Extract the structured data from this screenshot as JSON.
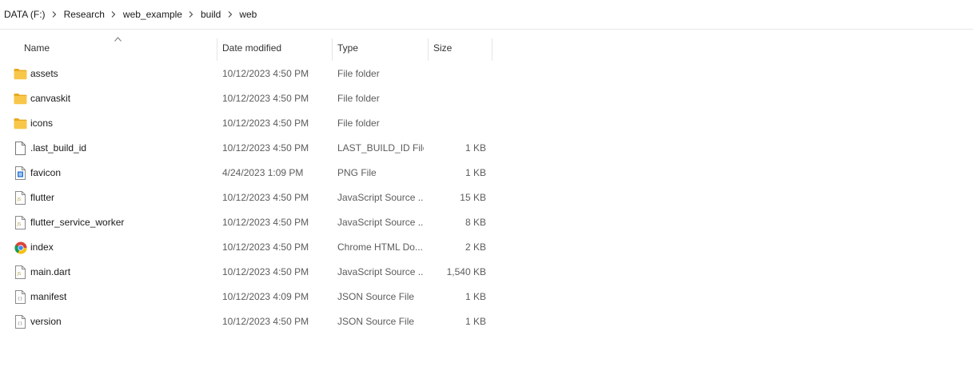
{
  "breadcrumb": [
    {
      "label": "DATA (F:)"
    },
    {
      "label": "Research"
    },
    {
      "label": "web_example"
    },
    {
      "label": "build"
    },
    {
      "label": "web"
    }
  ],
  "columns": {
    "name": "Name",
    "date": "Date modified",
    "type": "Type",
    "size": "Size",
    "sorted_by": "Name"
  },
  "files": [
    {
      "name": "assets",
      "date": "10/12/2023 4:50 PM",
      "type": "File folder",
      "size": "",
      "icon": "folder-icon"
    },
    {
      "name": "canvaskit",
      "date": "10/12/2023 4:50 PM",
      "type": "File folder",
      "size": "",
      "icon": "folder-icon"
    },
    {
      "name": "icons",
      "date": "10/12/2023 4:50 PM",
      "type": "File folder",
      "size": "",
      "icon": "folder-icon"
    },
    {
      "name": ".last_build_id",
      "date": "10/12/2023 4:50 PM",
      "type": "LAST_BUILD_ID File",
      "size": "1 KB",
      "icon": "blank-file-icon"
    },
    {
      "name": "favicon",
      "date": "4/24/2023 1:09 PM",
      "type": "PNG File",
      "size": "1 KB",
      "icon": "image-file-icon"
    },
    {
      "name": "flutter",
      "date": "10/12/2023 4:50 PM",
      "type": "JavaScript Source ...",
      "size": "15 KB",
      "icon": "js-file-icon"
    },
    {
      "name": "flutter_service_worker",
      "date": "10/12/2023 4:50 PM",
      "type": "JavaScript Source ...",
      "size": "8 KB",
      "icon": "js-file-icon"
    },
    {
      "name": "index",
      "date": "10/12/2023 4:50 PM",
      "type": "Chrome HTML Do...",
      "size": "2 KB",
      "icon": "chrome-icon"
    },
    {
      "name": "main.dart",
      "date": "10/12/2023 4:50 PM",
      "type": "JavaScript Source ...",
      "size": "1,540 KB",
      "icon": "js-file-icon"
    },
    {
      "name": "manifest",
      "date": "10/12/2023 4:09 PM",
      "type": "JSON Source File",
      "size": "1 KB",
      "icon": "json-file-icon"
    },
    {
      "name": "version",
      "date": "10/12/2023 4:50 PM",
      "type": "JSON Source File",
      "size": "1 KB",
      "icon": "json-file-icon"
    }
  ],
  "colors": {
    "folder": "#f8c74a",
    "folder_dark": "#e9a820",
    "chrome_red": "#db4437",
    "chrome_yellow": "#f4c20d",
    "chrome_green": "#0f9d58",
    "chrome_blue": "#4285f4",
    "image_blue": "#1e6fd1",
    "js_accent": "#c9b44a",
    "divider": "#e5e5e5"
  }
}
